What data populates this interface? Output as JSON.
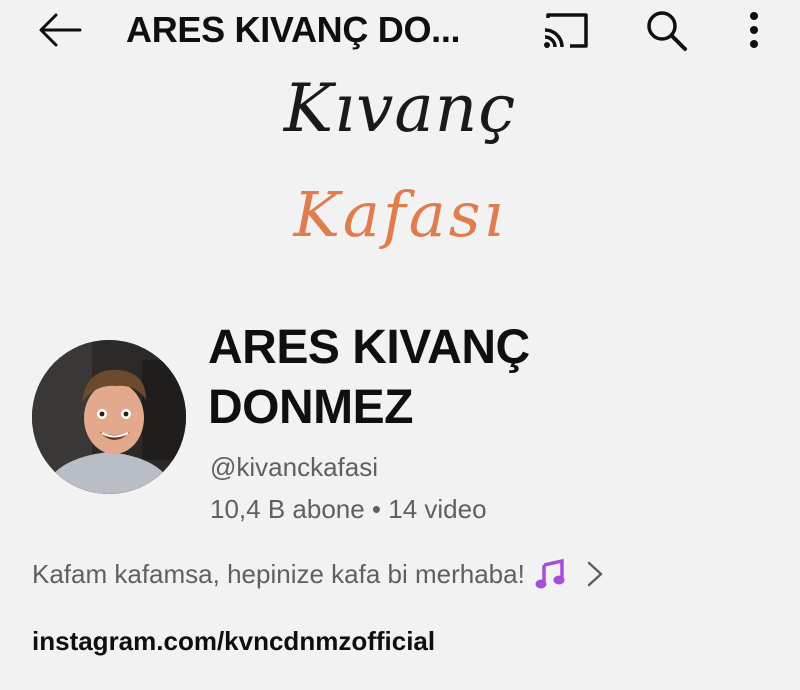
{
  "appbar": {
    "title": "ARES KIVANÇ DO...",
    "icons": [
      "back-arrow-icon",
      "cast-icon",
      "search-icon",
      "more-vertical-icon"
    ]
  },
  "banner": {
    "line1": "Kıvanç",
    "line2": "Kafası",
    "colors": {
      "line1": "#1a1a1a",
      "line2": "#e07d4e"
    }
  },
  "channel": {
    "name": "ARES KIVANÇ DONMEZ",
    "handle": "@kivanckafasi",
    "stats": "10,4 B abone • 14 video",
    "description": "Kafam kafamsa, hepinize kafa bi merhaba!",
    "link": "instagram.com/kvncdnmzofficial"
  },
  "colors": {
    "background": "#f2f2f2",
    "primary_text": "#0f0f0f",
    "secondary_text": "#606060",
    "music_note": "#a44fd6"
  }
}
